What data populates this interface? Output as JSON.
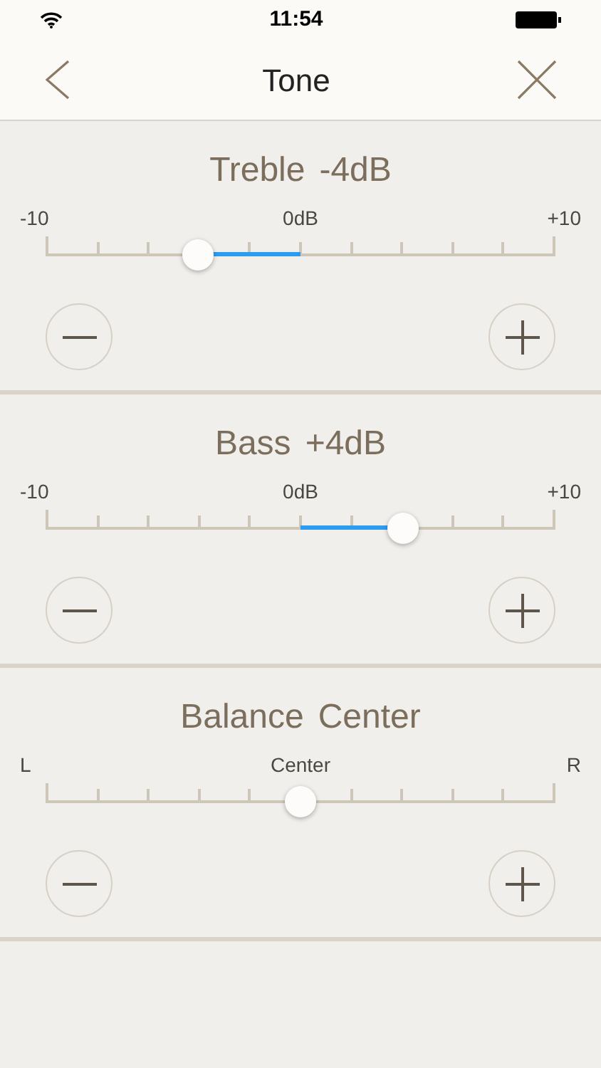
{
  "status_bar": {
    "time": "11:54"
  },
  "nav": {
    "title": "Tone"
  },
  "sections": [
    {
      "name": "Treble",
      "value": "-4dB",
      "labels": [
        "-10",
        "0dB",
        "+10"
      ],
      "level": 0.3
    },
    {
      "name": "Bass",
      "value": "+4dB",
      "labels": [
        "-10",
        "0dB",
        "+10"
      ],
      "level": 0.7
    },
    {
      "name": "Balance",
      "value": "Center",
      "labels": [
        "L",
        "Center",
        "R"
      ],
      "level": 0.5
    }
  ]
}
